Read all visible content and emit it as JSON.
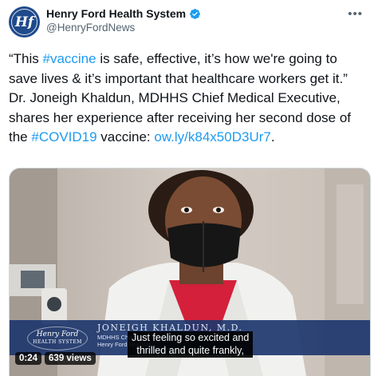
{
  "account": {
    "name": "Henry Ford Health System",
    "handle": "@HenryFordNews",
    "avatar_mark": "Hf",
    "verified_icon": "verified-badge-icon"
  },
  "menu_icon": "more-options-icon",
  "tweet": {
    "p1": "“This ",
    "tag1": "#vaccine",
    "p2": " is safe, effective, it’s how we're going to save lives & it’s important that healthcare workers get it.” Dr. Joneigh Khaldun, MDHHS Chief Medical Executive, shares her experience after receiving her second dose of the ",
    "tag2": "#COVID19",
    "p3": " vaccine: ",
    "url": "ow.ly/k84x50D3Ur7",
    "p4": "."
  },
  "video": {
    "lower_third": {
      "logo_line1": "Henry Ford",
      "logo_line2": "HEALTH SYSTEM",
      "name": "JONEIGH KHALDUN, M.D.",
      "role_line1": "MDHHS Chief M...",
      "role_line2": "Henry Ford Hospital ..."
    },
    "caption_line1": "Just feeling so excited and",
    "caption_line2": "thrilled and quite frankly,",
    "time": "0:24",
    "views": "639 views"
  },
  "colors": {
    "accent": "#1d9bf0",
    "text": "#0f1419",
    "secondary": "#536471",
    "avatar_bg": "#1f4a8c",
    "lower_third_bg": "#1e376e"
  }
}
